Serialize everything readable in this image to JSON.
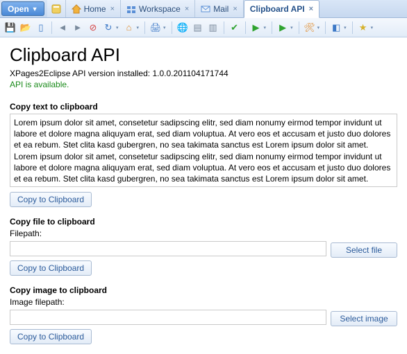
{
  "open_label": "Open",
  "tabs": {
    "home": "Home",
    "workspace": "Workspace",
    "mail": "Mail",
    "clipboard": "Clipboard API"
  },
  "page": {
    "title": "Clipboard API",
    "version_line": "XPages2Eclipse API version installed: 1.0.0.201104171744",
    "status": "API is available."
  },
  "section_text": {
    "title": "Copy text to clipboard",
    "body": "Lorem ipsum dolor sit amet, consetetur sadipscing elitr, sed diam nonumy eirmod tempor invidunt ut labore et dolore magna aliquyam erat, sed diam voluptua. At vero eos et accusam et justo duo dolores et ea rebum. Stet clita kasd gubergren, no sea takimata sanctus est Lorem ipsum dolor sit amet. Lorem ipsum dolor sit amet, consetetur sadipscing elitr, sed diam nonumy eirmod tempor invidunt ut labore et dolore magna aliquyam erat, sed diam voluptua. At vero eos et accusam et justo duo dolores et ea rebum. Stet clita kasd gubergren, no sea takimata sanctus est Lorem ipsum dolor sit amet.",
    "button": "Copy to Clipboard"
  },
  "section_file": {
    "title": "Copy file to clipboard",
    "label": "Filepath:",
    "value": "",
    "select": "Select file",
    "button": "Copy to Clipboard"
  },
  "section_image": {
    "title": "Copy image to clipboard",
    "label": "Image filepath:",
    "value": "",
    "select": "Select image",
    "button": "Copy to Clipboard"
  }
}
